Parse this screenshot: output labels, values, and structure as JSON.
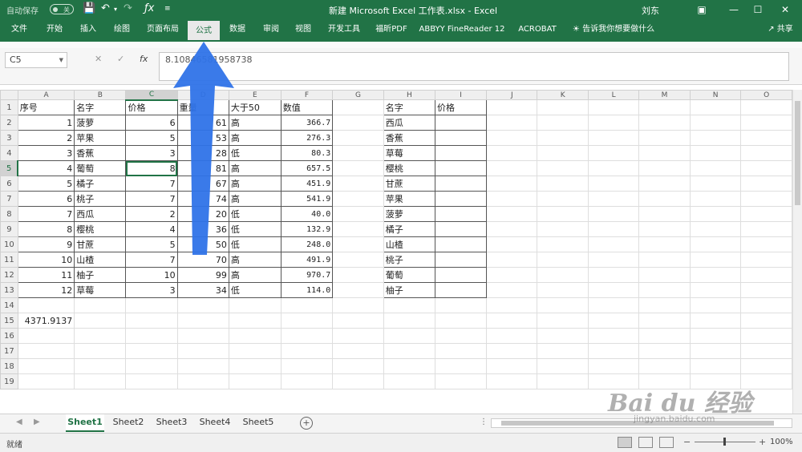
{
  "titlebar": {
    "autosave_label": "自动保存",
    "autosave_state": "关",
    "window_title": "新建 Microsoft Excel 工作表.xlsx  -  Excel",
    "user": "刘东"
  },
  "ribbon": {
    "tabs": [
      "文件",
      "开始",
      "插入",
      "绘图",
      "页面布局",
      "公式",
      "数据",
      "审阅",
      "视图",
      "开发工具",
      "福昕PDF",
      "ABBYY FineReader 12",
      "ACROBAT"
    ],
    "active_tab": "公式",
    "tell_me": "告诉我你想要做什么",
    "share": "共享"
  },
  "formula_bar": {
    "name_box": "C5",
    "fx_label": "fx",
    "formula": "8.10846581958738"
  },
  "columns": [
    "A",
    "B",
    "C",
    "D",
    "E",
    "F",
    "G",
    "H",
    "I",
    "J",
    "K",
    "L",
    "M",
    "N",
    "O"
  ],
  "rows": [
    {
      "n": "1",
      "A": "序号",
      "B": "名字",
      "C": "价格",
      "D": "重量",
      "E": "大于50",
      "F": "数值",
      "H": "名字",
      "I": "价格"
    },
    {
      "n": "2",
      "A": "1",
      "B": "菠萝",
      "C": "6",
      "D": "61",
      "E": "高",
      "F": "366.7",
      "H": "西瓜",
      "I": ""
    },
    {
      "n": "3",
      "A": "2",
      "B": "苹果",
      "C": "5",
      "D": "53",
      "E": "高",
      "F": "276.3",
      "H": "香蕉",
      "I": ""
    },
    {
      "n": "4",
      "A": "3",
      "B": "香蕉",
      "C": "3",
      "D": "28",
      "E": "低",
      "F": "80.3",
      "H": "草莓",
      "I": ""
    },
    {
      "n": "5",
      "A": "4",
      "B": "葡萄",
      "C": "8",
      "D": "81",
      "E": "高",
      "F": "657.5",
      "H": "樱桃",
      "I": ""
    },
    {
      "n": "6",
      "A": "5",
      "B": "橘子",
      "C": "7",
      "D": "67",
      "E": "高",
      "F": "451.9",
      "H": "甘蔗",
      "I": ""
    },
    {
      "n": "7",
      "A": "6",
      "B": "桃子",
      "C": "7",
      "D": "74",
      "E": "高",
      "F": "541.9",
      "H": "苹果",
      "I": ""
    },
    {
      "n": "8",
      "A": "7",
      "B": "西瓜",
      "C": "2",
      "D": "20",
      "E": "低",
      "F": "40.0",
      "H": "菠萝",
      "I": ""
    },
    {
      "n": "9",
      "A": "8",
      "B": "樱桃",
      "C": "4",
      "D": "36",
      "E": "低",
      "F": "132.9",
      "H": "橘子",
      "I": ""
    },
    {
      "n": "10",
      "A": "9",
      "B": "甘蔗",
      "C": "5",
      "D": "50",
      "E": "低",
      "F": "248.0",
      "H": "山楂",
      "I": ""
    },
    {
      "n": "11",
      "A": "10",
      "B": "山楂",
      "C": "7",
      "D": "70",
      "E": "高",
      "F": "491.9",
      "H": "桃子",
      "I": ""
    },
    {
      "n": "12",
      "A": "11",
      "B": "柚子",
      "C": "10",
      "D": "99",
      "E": "高",
      "F": "970.7",
      "H": "葡萄",
      "I": ""
    },
    {
      "n": "13",
      "A": "12",
      "B": "草莓",
      "C": "3",
      "D": "34",
      "E": "低",
      "F": "114.0",
      "H": "柚子",
      "I": ""
    },
    {
      "n": "14"
    },
    {
      "n": "15",
      "A": "4371.9137"
    },
    {
      "n": "16"
    },
    {
      "n": "17"
    },
    {
      "n": "18"
    },
    {
      "n": "19"
    }
  ],
  "sheets": [
    "Sheet1",
    "Sheet2",
    "Sheet3",
    "Sheet4",
    "Sheet5"
  ],
  "active_sheet": "Sheet1",
  "status": {
    "ready": "就绪",
    "zoom": "100%"
  },
  "watermark": {
    "logo": "Bai du 经验",
    "url": "jingyan.baidu.com"
  },
  "colors": {
    "excel_green": "#217346",
    "arrow_blue": "#2f73e8"
  }
}
